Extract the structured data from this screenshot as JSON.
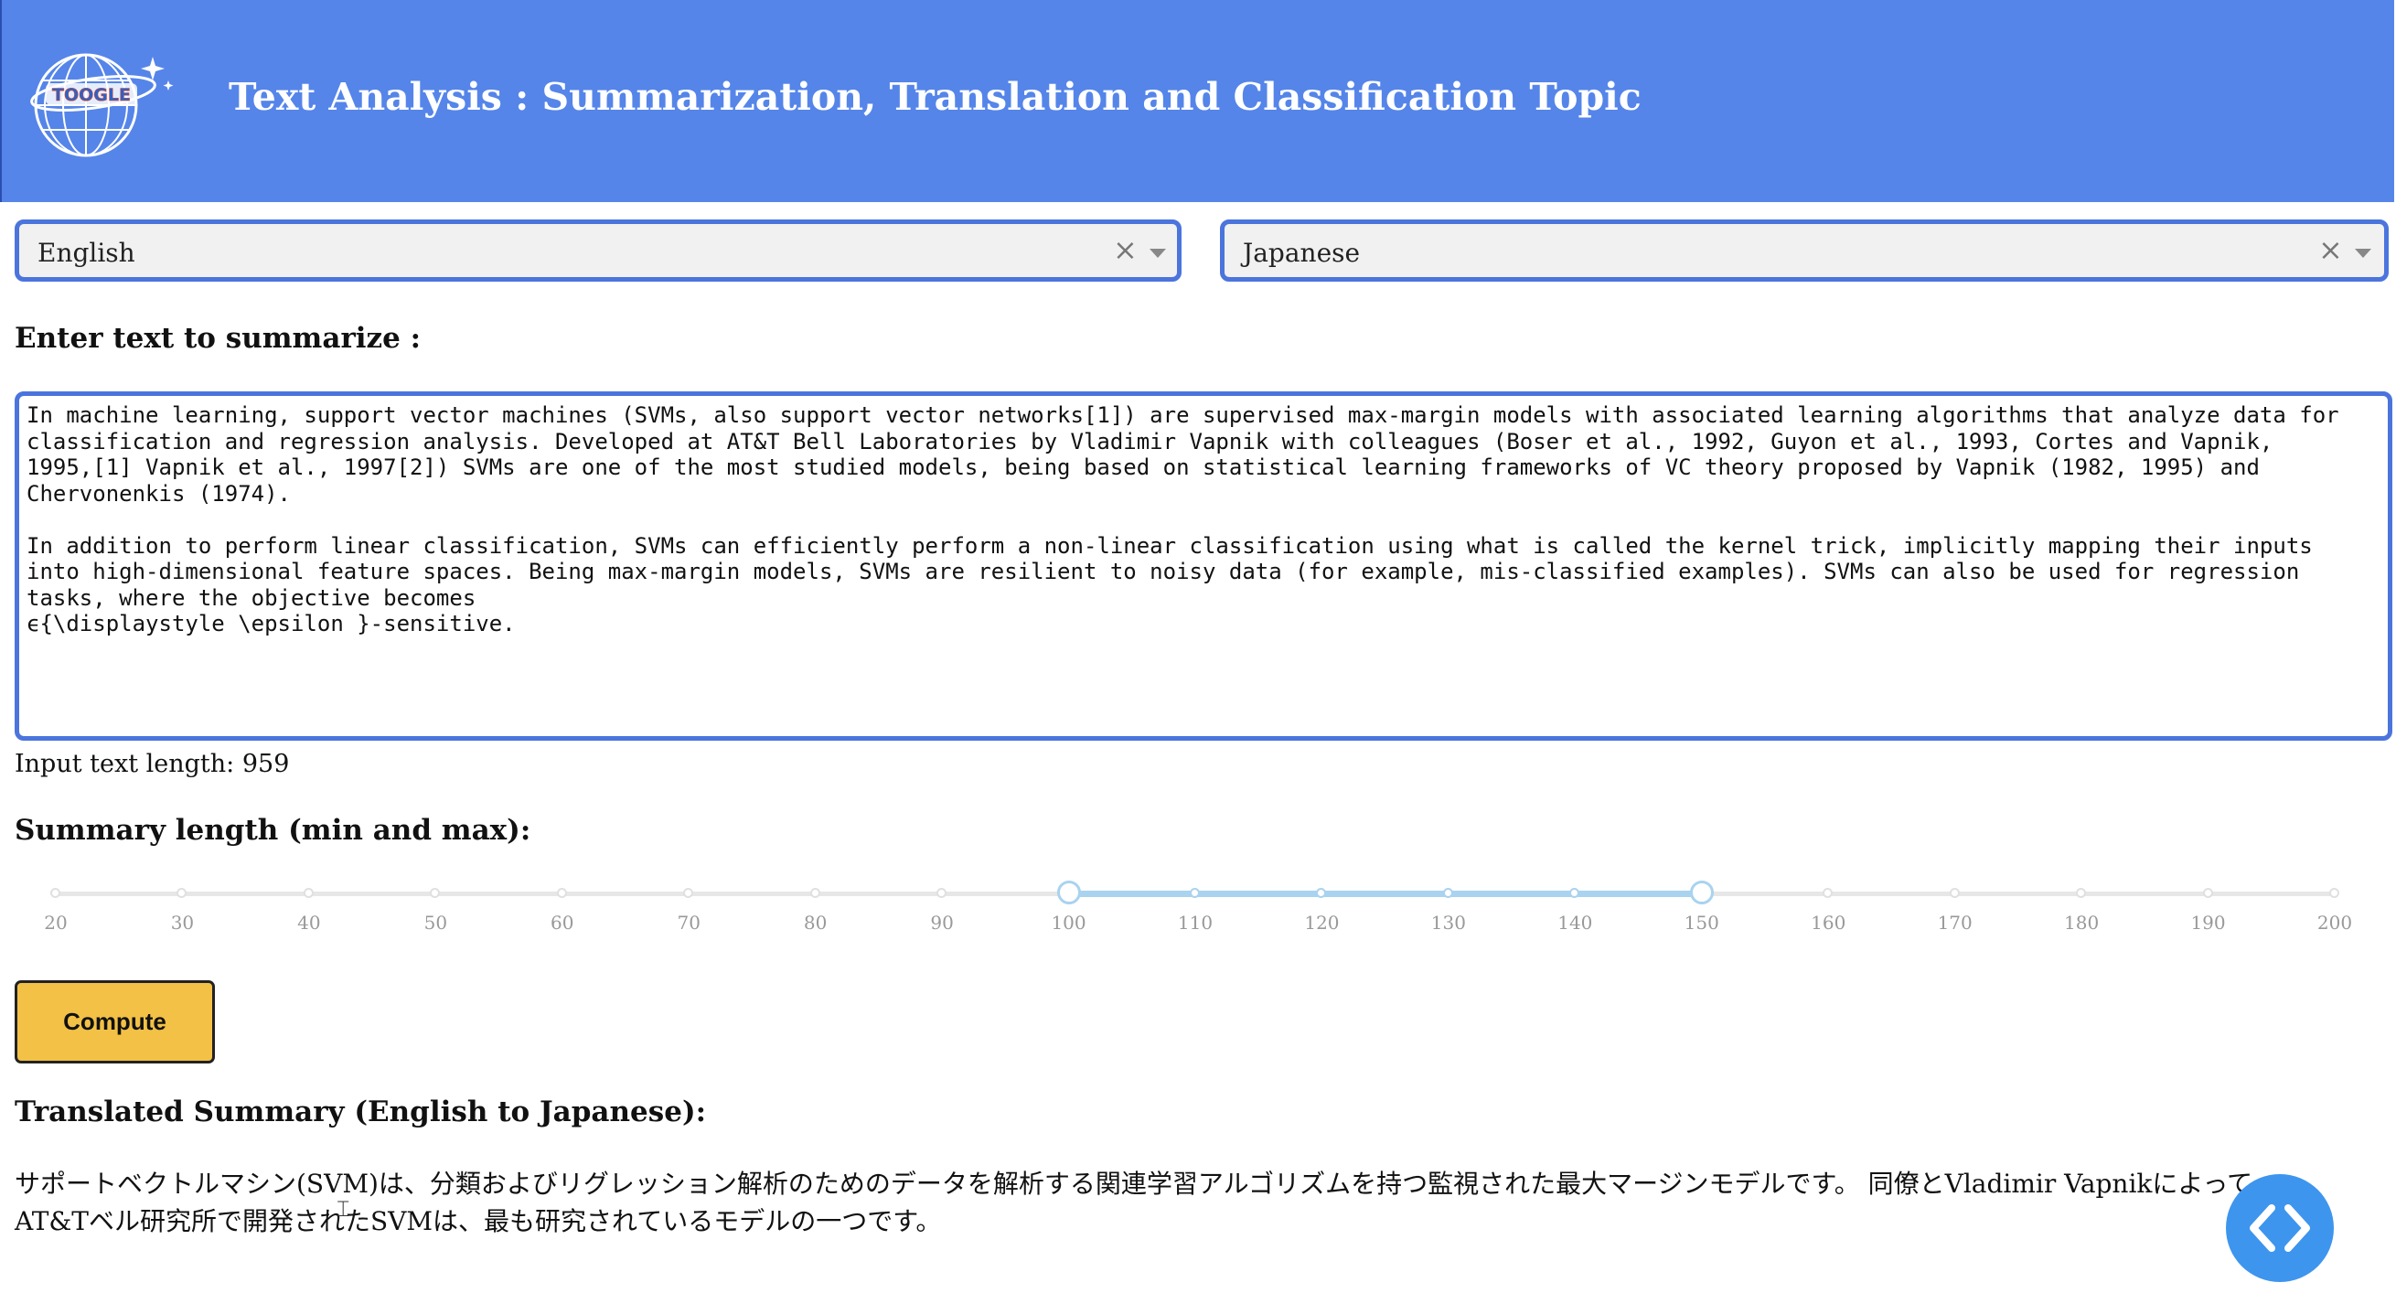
{
  "header": {
    "title": "Text Analysis : Summarization, Translation and Classification Topic",
    "logo_text": "TOOGLE"
  },
  "source_language": {
    "value": "English",
    "clear_glyph": "×"
  },
  "target_language": {
    "value": "Japanese",
    "clear_glyph": "×"
  },
  "input_section": {
    "heading": "Enter text to summarize :",
    "text": "In machine learning, support vector machines (SVMs, also support vector networks[1]) are supervised max-margin models with associated learning algorithms that analyze data for\nclassification and regression analysis. Developed at AT&T Bell Laboratories by Vladimir Vapnik with colleagues (Boser et al., 1992, Guyon et al., 1993, Cortes and Vapnik,\n1995,[1] Vapnik et al., 1997[2]) SVMs are one of the most studied models, being based on statistical learning frameworks of VC theory proposed by Vapnik (1982, 1995) and\nChervonenkis (1974).\n\nIn addition to perform linear classification, SVMs can efficiently perform a non-linear classification using what is called the kernel trick, implicitly mapping their inputs\ninto high-dimensional feature spaces. Being max-margin models, SVMs are resilient to noisy data (for example, mis-classified examples). SVMs can also be used for regression\ntasks, where the objective becomes\nϵ{\\displaystyle \\epsilon }-sensitive.",
    "length_label": "Input text length: 959"
  },
  "summary_length": {
    "heading": "Summary length (min and max):",
    "ticks": [
      20,
      30,
      40,
      50,
      60,
      70,
      80,
      90,
      100,
      110,
      120,
      130,
      140,
      150,
      160,
      170,
      180,
      190,
      200
    ],
    "min": 20,
    "max": 200,
    "selected_min": 100,
    "selected_max": 150
  },
  "compute_button": {
    "label": "Compute"
  },
  "result": {
    "heading": "Translated Summary (English to Japanese):",
    "text": "サポートベクトルマシン(SVM)は、分類およびリグレッション解析のためのデータを解析する関連学習アルゴリズムを持つ監視された最大マージンモデルです。 同僚とVladimir Vapnikによって AT&Tベル研究所で開発されたSVMは、最も研究されているモデルの一つです。"
  },
  "colors": {
    "header_bg": "#5585e9",
    "select_border": "#4b74dd",
    "slider_range": "#a9d3ef",
    "button_bg": "#f2c145",
    "fab_bg": "#3d95ee"
  },
  "icons": {
    "logo": "globe-logo-icon",
    "clear": "clear-x-icon",
    "dropdown": "chevron-down-icon",
    "fab": "code-brackets-icon"
  }
}
